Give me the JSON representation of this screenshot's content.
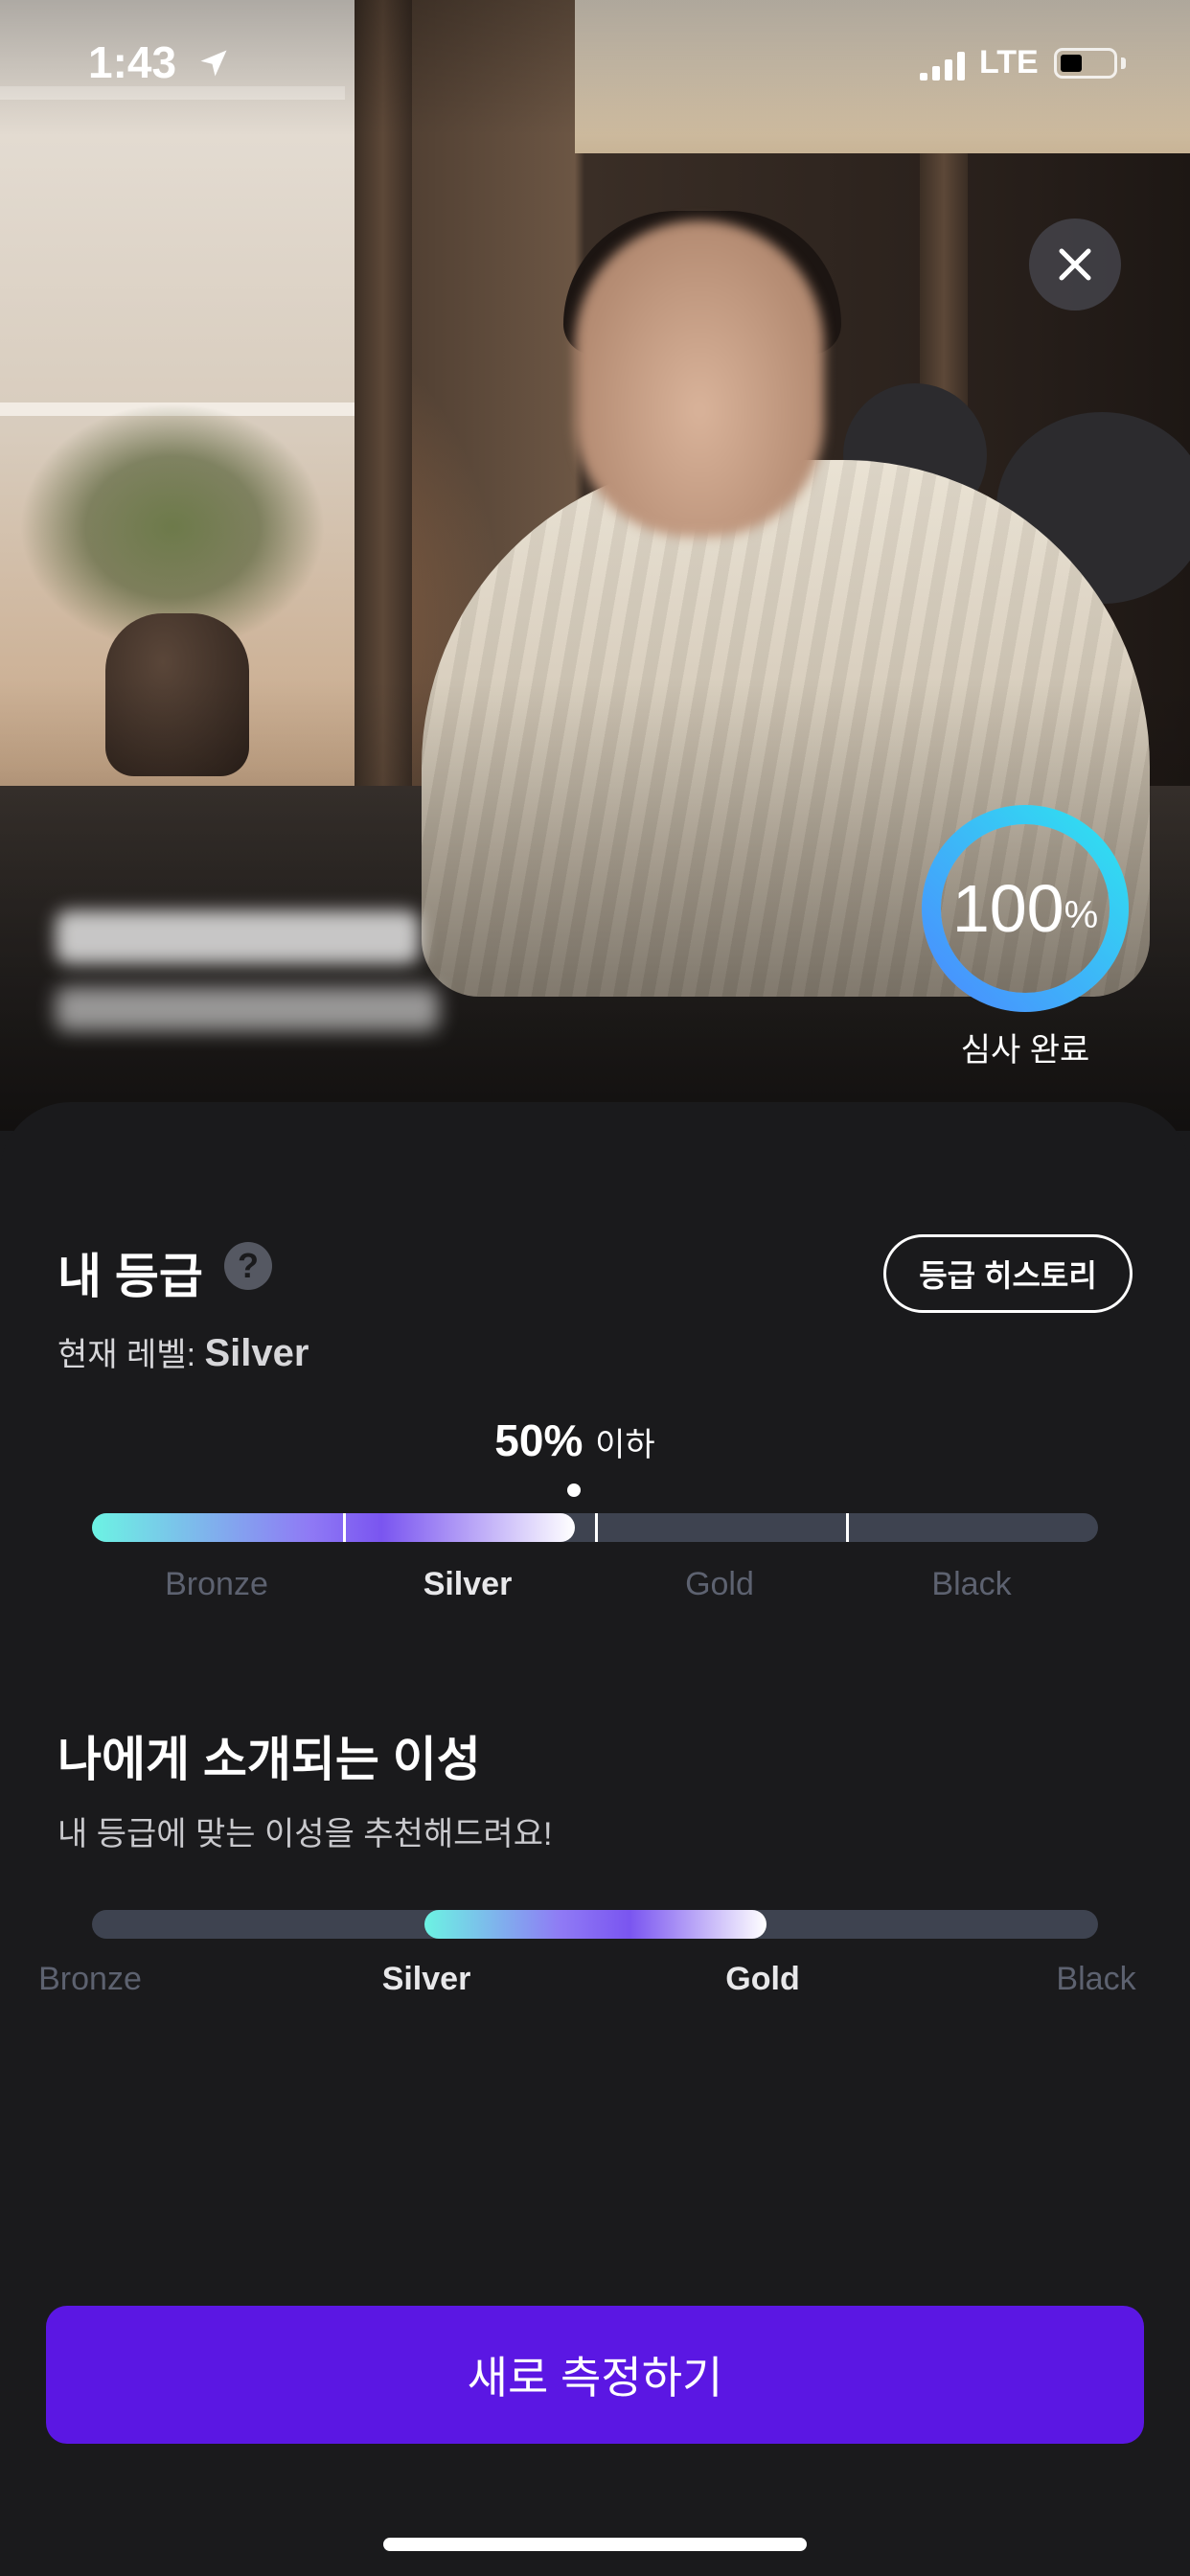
{
  "status_bar": {
    "time": "1:43",
    "network": "LTE"
  },
  "progress_ring": {
    "value": 100,
    "percent_text": "100",
    "percent_unit": "%",
    "caption": "심사 완료",
    "color_start": "#4a8cff",
    "color_end": "#2fe3f0"
  },
  "grade": {
    "title": "내 등급",
    "help_symbol": "?",
    "history_button": "등급 히스토리",
    "level_prefix": "현재 레벨:",
    "level_value": "Silver",
    "percentile": "50%",
    "percentile_suffix": "이하",
    "position_fraction": 0.48,
    "tiers": [
      "Bronze",
      "Silver",
      "Gold",
      "Black"
    ],
    "active_tier": "Silver"
  },
  "match": {
    "title": "나에게 소개되는 이성",
    "subtitle": "내 등급에 맞는 이성을 추천해드려요!",
    "tiers": [
      "Bronze",
      "Silver",
      "Gold",
      "Black"
    ],
    "range_start_fraction": 0.33,
    "range_end_fraction": 0.67,
    "active_tiers": [
      "Silver",
      "Gold"
    ]
  },
  "cta": {
    "label": "새로 측정하기",
    "color": "#5b17e3"
  },
  "icons": [
    "location-arrow-icon",
    "signal-icon",
    "battery-icon",
    "close-icon",
    "help-icon"
  ]
}
